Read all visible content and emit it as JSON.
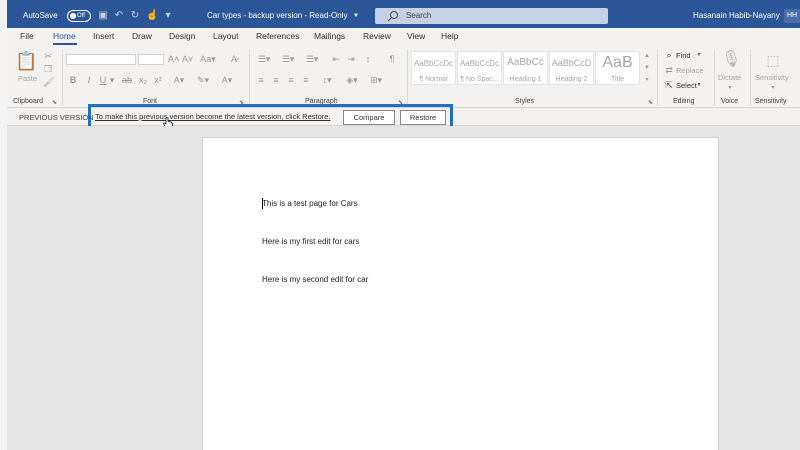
{
  "titlebar": {
    "autosave_label": "AutoSave",
    "autosave_state": "Off",
    "doc_title": "Car types - backup version  -  Read-Only",
    "search_placeholder": "Search",
    "user_name": "Hasanain Habib-Nayany",
    "user_initials": "HH"
  },
  "tabs": [
    "File",
    "Home",
    "Insert",
    "Draw",
    "Design",
    "Layout",
    "References",
    "Mailings",
    "Review",
    "View",
    "Help"
  ],
  "ribbon": {
    "clipboard": {
      "paste_label": "Paste",
      "group_label": "Clipboard"
    },
    "font": {
      "group_label": "Font"
    },
    "paragraph": {
      "group_label": "Paragraph"
    },
    "styles": {
      "group_label": "Styles",
      "items": [
        {
          "preview": "AaBbCcDc",
          "name": "¶ Normal"
        },
        {
          "preview": "AaBbCcDc",
          "name": "¶ No Spac..."
        },
        {
          "preview": "AaBbCc",
          "name": "Heading 1"
        },
        {
          "preview": "AaBbCcD",
          "name": "Heading 2"
        },
        {
          "preview": "AaB",
          "name": "Title"
        }
      ]
    },
    "editing": {
      "find": "Find",
      "replace": "Replace",
      "select": "Select",
      "group_label": "Editing"
    },
    "voice": {
      "dictate": "Dictate",
      "group_label": "Voice"
    },
    "sensitivity": {
      "button_label": "Sensitivity",
      "group_label": "Sensitivity"
    }
  },
  "previous_version_bar": {
    "label": "PREVIOUS VERSION",
    "message": "To make this previous version become the latest version, click Restore.",
    "compare_label": "Compare",
    "restore_label": "Restore"
  },
  "document": {
    "paragraphs": [
      "This is a test page for Cars",
      "Here is my first edit for cars",
      "Here is my second edit for car"
    ]
  },
  "colors": {
    "titlebar": "#2b579a",
    "highlight_border": "#1f6fc5",
    "ribbon_bg": "#f3f2f1"
  }
}
